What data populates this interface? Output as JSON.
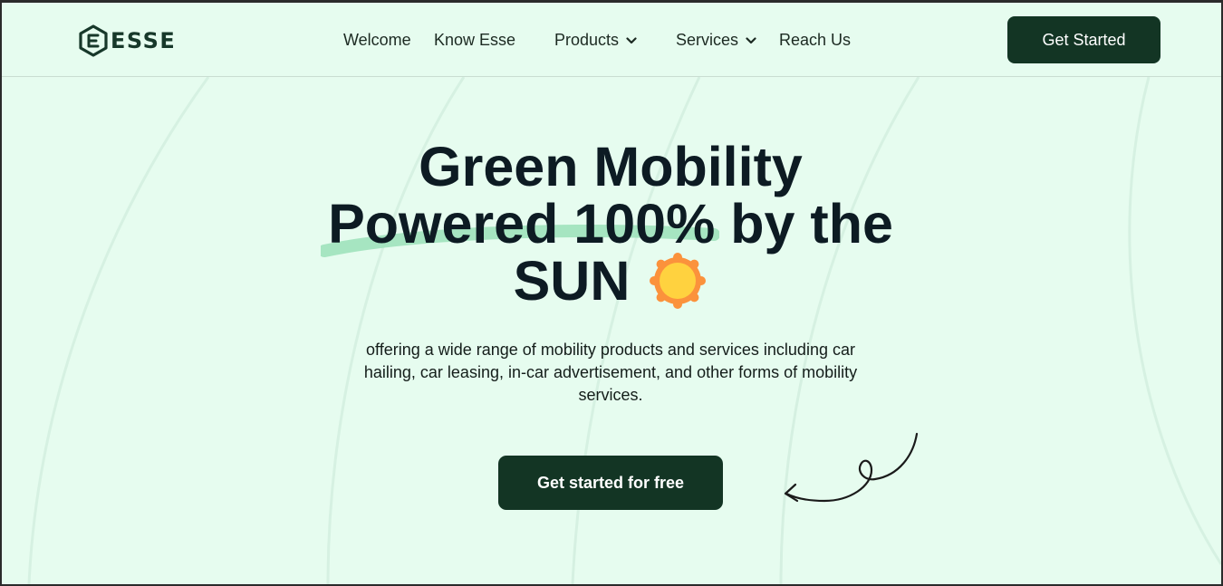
{
  "brand": {
    "name": "ESSE",
    "primary_color": "#133524",
    "background_color": "#e6fcef",
    "accent_stroke_color": "#9fe2bb",
    "sun_colors": [
      "#fb923c",
      "#ffd23f"
    ]
  },
  "nav": {
    "items": [
      {
        "label": "Welcome",
        "has_dropdown": false
      },
      {
        "label": "Know Esse",
        "has_dropdown": false
      },
      {
        "label": "Products",
        "has_dropdown": true,
        "icon": "chevron-down-icon"
      },
      {
        "label": "Services",
        "has_dropdown": true,
        "icon": "chevron-down-icon"
      },
      {
        "label": "Reach Us",
        "has_dropdown": false
      }
    ],
    "cta_label": "Get Started"
  },
  "hero": {
    "headline_lines": [
      "Green Mobility",
      "Powered 100% by the",
      "SUN"
    ],
    "headline_icon": "sun-icon",
    "subtitle": "offering a wide range of mobility products and services including car hailing, car leasing, in-car advertisement, and other forms of mobility services.",
    "cta_label": "Get started for free",
    "decoration_icon": "curly-arrow-icon"
  }
}
